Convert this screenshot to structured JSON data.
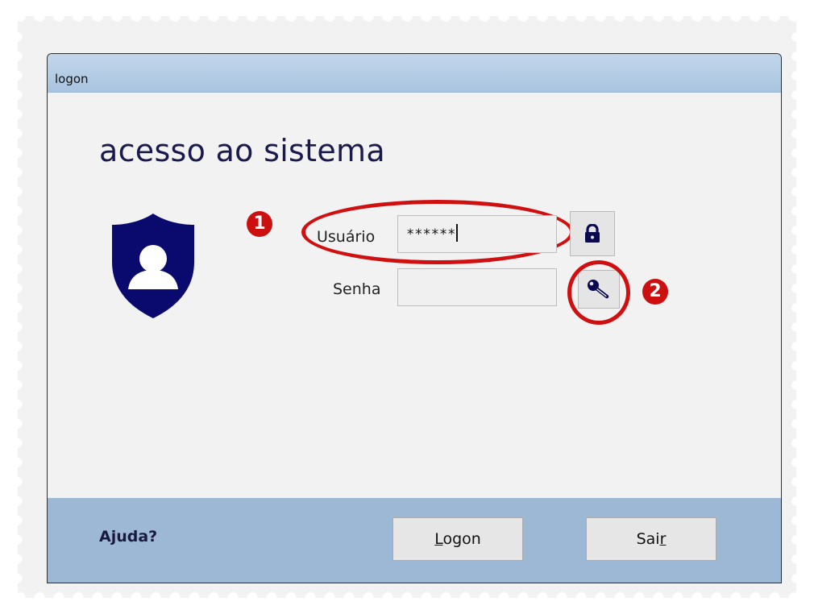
{
  "window": {
    "title": "logon",
    "heading": "acesso ao sistema"
  },
  "form": {
    "user_label": "Usuário",
    "user_value": "******",
    "password_label": "Senha",
    "password_value": ""
  },
  "annotations": {
    "badge_1": "1",
    "badge_2": "2"
  },
  "footer": {
    "help_link": "Ajuda?",
    "logon_button": {
      "mnemonic": "L",
      "rest": "ogon"
    },
    "exit_button": {
      "prefix": "Sai",
      "mnemonic": "r"
    }
  },
  "icons": {
    "shield": "user-shield-icon",
    "lock": "lock-icon",
    "key": "key-icon"
  },
  "colors": {
    "titlebar": "#b3cbe5",
    "footer": "#9db8d4",
    "annotation_red": "#d01010",
    "shield_navy": "#0a0a6e"
  }
}
